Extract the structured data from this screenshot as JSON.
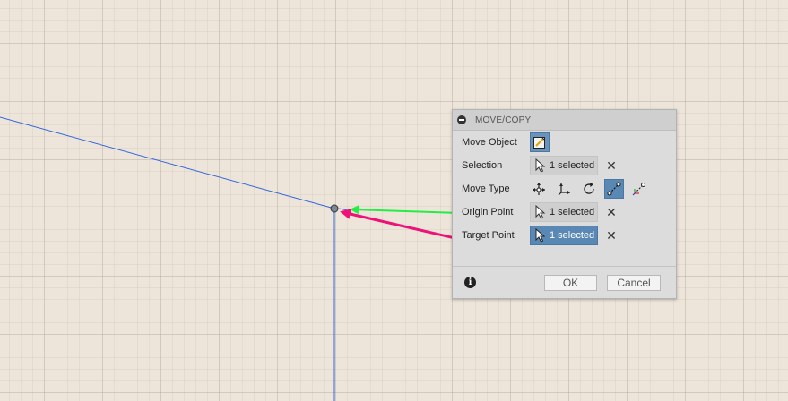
{
  "dialog": {
    "title": "MOVE/COPY",
    "rows": {
      "move_object": {
        "label": "Move Object"
      },
      "selection": {
        "label": "Selection",
        "value": "1 selected"
      },
      "move_type": {
        "label": "Move Type"
      },
      "origin_point": {
        "label": "Origin Point",
        "value": "1 selected"
      },
      "target_point": {
        "label": "Target Point",
        "value": "1 selected"
      }
    },
    "move_types": [
      "translate-icon",
      "move-axes-icon",
      "rotate-icon",
      "point-to-point-icon",
      "point-to-position-icon"
    ],
    "active_move_type": "point-to-point-icon",
    "buttons": {
      "ok": "OK",
      "cancel": "Cancel"
    }
  },
  "annotations": {
    "green_arrow_color": "#22ee44",
    "magenta_arrow_color": "#ee1177"
  },
  "colors": {
    "sketch_line": "#3366dd",
    "accent": "#5a88b4",
    "canvas": "#ede5da"
  }
}
